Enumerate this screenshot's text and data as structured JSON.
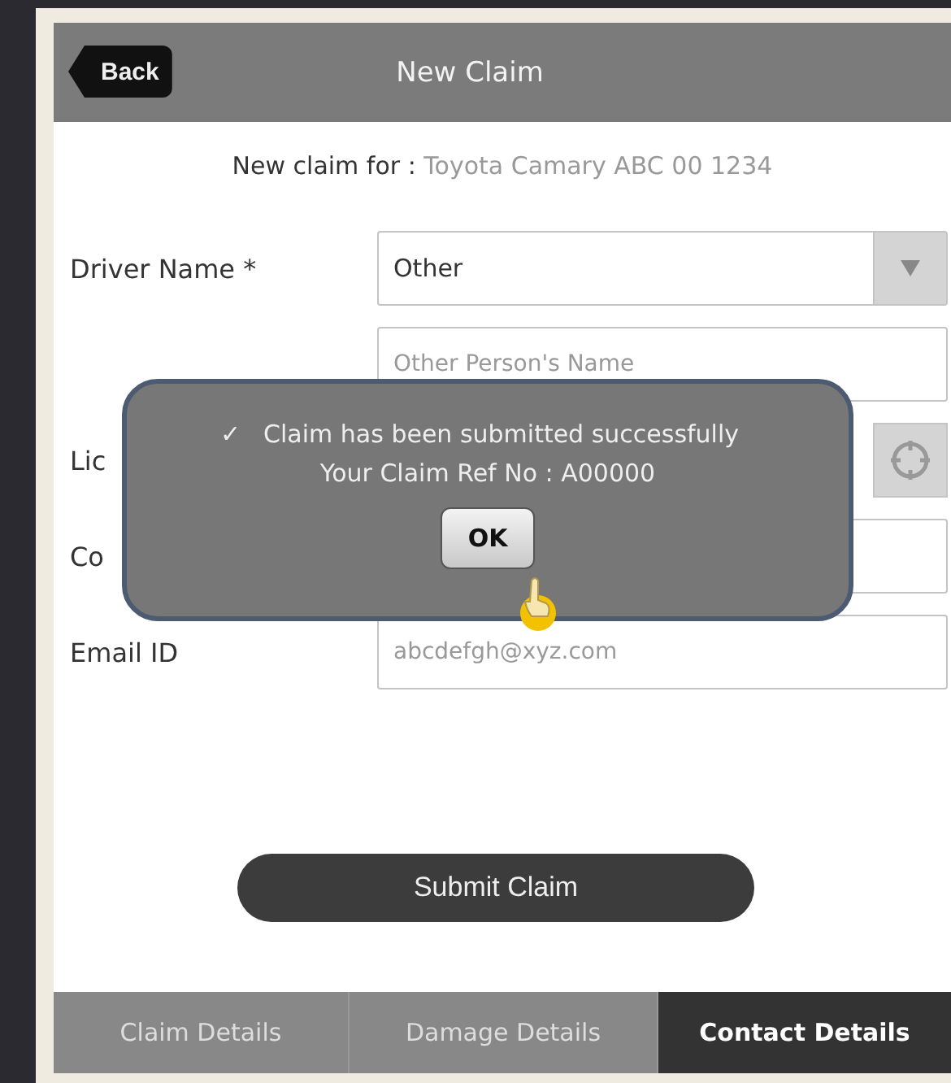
{
  "header": {
    "back_button": "Back",
    "title": "New Claim"
  },
  "subtitle": {
    "label": "New claim for :",
    "vehicle": "Toyota Camary ABC 00 1234"
  },
  "fields": [
    {
      "label": "Driver Name *",
      "kind": "select",
      "value": "Other"
    },
    {
      "kind": "input",
      "placeholder": "Other Person's Name"
    },
    {
      "label": "Lic",
      "kind": "locate"
    },
    {
      "label": "Co",
      "kind": "input"
    },
    {
      "label": "Email ID",
      "kind": "input",
      "placeholder": "abcdefgh@xyz.com"
    }
  ],
  "dialog": {
    "check": "✓",
    "message": "Claim has been submitted successfully",
    "reference": "Your Claim Ref No : A00000",
    "button": "OK"
  },
  "submit_button": "Submit Claim",
  "tabs": [
    {
      "label": "Claim Details",
      "selected": false
    },
    {
      "label": "Damage Details",
      "selected": false
    },
    {
      "label": "Contact Details",
      "selected": true
    }
  ]
}
